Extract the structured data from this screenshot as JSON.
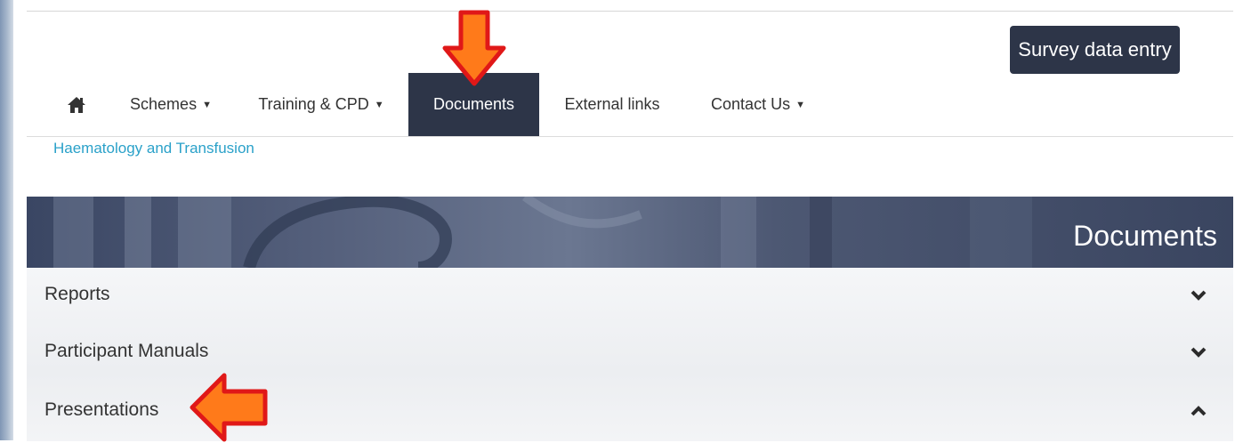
{
  "header": {
    "survey_button": "Survey data entry",
    "brand_subtitle": "Haematology and Transfusion"
  },
  "nav": {
    "home_icon": "home-icon",
    "items": [
      {
        "label": "Schemes",
        "dropdown": true
      },
      {
        "label": "Training & CPD",
        "dropdown": true
      },
      {
        "label": "Documents",
        "dropdown": false,
        "active": true
      },
      {
        "label": "External links",
        "dropdown": false
      },
      {
        "label": "Contact Us",
        "dropdown": true
      }
    ]
  },
  "banner": {
    "title": "Documents"
  },
  "accordion": {
    "items": [
      {
        "label": "Reports",
        "expanded": false
      },
      {
        "label": "Participant Manuals",
        "expanded": false
      },
      {
        "label": "Presentations",
        "expanded": true
      }
    ]
  },
  "colors": {
    "nav_active_bg": "#2d3548",
    "brand_subtitle": "#2aa1c9",
    "annotation_arrow": "#ff7a1a",
    "annotation_arrow_outline": "#e01818"
  }
}
